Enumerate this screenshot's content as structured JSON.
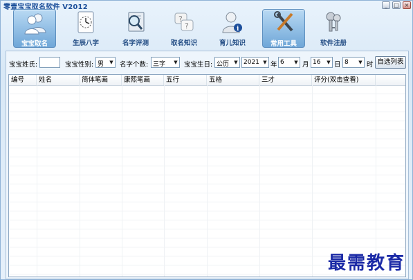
{
  "window": {
    "title": "零壹宝宝取名软件 V2012",
    "buttons": {
      "minimize": "_",
      "maximize": "□",
      "close": "×"
    }
  },
  "toolbar": {
    "items": [
      {
        "label": "宝宝取名",
        "icon": "people-icon",
        "active": true
      },
      {
        "label": "生辰八字",
        "icon": "clock-icon",
        "active": false
      },
      {
        "label": "名字评测",
        "icon": "magnifier-book-icon",
        "active": false
      },
      {
        "label": "取名知识",
        "icon": "question-bubbles-icon",
        "active": false
      },
      {
        "label": "育儿知识",
        "icon": "person-info-icon",
        "active": false
      },
      {
        "label": "常用工具",
        "icon": "tools-icon",
        "active": true
      },
      {
        "label": "软件注册",
        "icon": "keys-icon",
        "active": false
      }
    ]
  },
  "filters": {
    "surname_label": "宝宝姓氏:",
    "surname_value": "",
    "gender_label": "宝宝性别:",
    "gender_value": "男",
    "name_count_label": "名字个数:",
    "name_count_value": "三字",
    "birthday_label": "宝宝生日:",
    "calendar_value": "公历",
    "year_value": "2021",
    "year_unit": "年",
    "month_value": "6",
    "month_unit": "月",
    "day_value": "16",
    "day_unit": "日",
    "hour_value": "8",
    "hour_unit": "时",
    "custom_button": "自选列表"
  },
  "table": {
    "columns": [
      "编号",
      "姓名",
      "简体笔画",
      "康熙笔画",
      "五行",
      "五格",
      "三才",
      "评分(双击查看)"
    ],
    "rows": []
  },
  "watermark": "最需教育"
}
